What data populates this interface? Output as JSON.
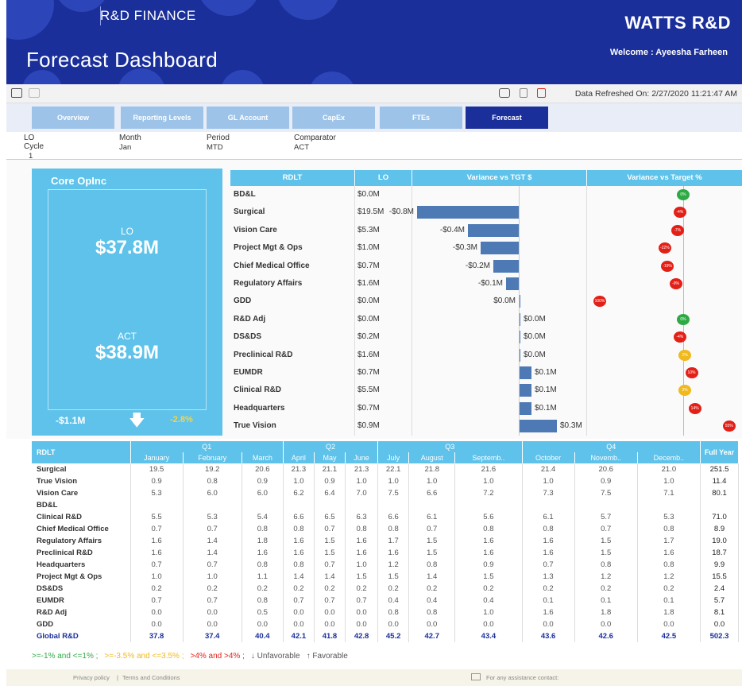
{
  "header": {
    "brand_sub": "R&D FINANCE",
    "title": "Forecast Dashboard",
    "logo": "WATTS R&D",
    "welcome": "Welcome : Ayeesha Farheen"
  },
  "toolbar": {
    "refreshed": "Data Refreshed On: 2/27/2020 11:21:47 AM",
    "icons": [
      "laptop-icon",
      "tablet-icon",
      "present-icon",
      "mobile-icon",
      "pdf-icon"
    ]
  },
  "tabs": [
    {
      "label": "Overview",
      "active": false
    },
    {
      "label": "Reporting Levels",
      "active": false
    },
    {
      "label": "GL Account",
      "active": false
    },
    {
      "label": "CapEx",
      "active": false
    },
    {
      "label": "FTEs",
      "active": false
    },
    {
      "label": "Forecast",
      "active": true
    }
  ],
  "filters": [
    {
      "label": "LO Cycle",
      "value": "1"
    },
    {
      "label": "Month",
      "value": "Jan"
    },
    {
      "label": "Period",
      "value": "MTD"
    },
    {
      "label": "Comparator",
      "value": "ACT"
    }
  ],
  "core": {
    "title": "Core OpInc",
    "lo_label": "LO",
    "lo_value": "$37.8M",
    "act_label": "ACT",
    "act_value": "$38.9M",
    "variance": "-$1.1M",
    "variance_pct": "-2.8%"
  },
  "rdlt_panel": {
    "col_rdlt": "RDLT",
    "col_lo": "LO",
    "col_var_tgt": "Variance vs TGT $",
    "col_var_pct": "Variance vs Target %",
    "rows": [
      {
        "name": "BD&L",
        "lo": "$0.0M"
      },
      {
        "name": "Surgical",
        "lo": "$19.5M"
      },
      {
        "name": "Vision Care",
        "lo": "$5.3M"
      },
      {
        "name": "Project Mgt & Ops",
        "lo": "$1.0M"
      },
      {
        "name": "Chief Medical Office",
        "lo": "$0.7M"
      },
      {
        "name": "Regulatory Affairs",
        "lo": "$1.6M"
      },
      {
        "name": "GDD",
        "lo": "$0.0M"
      },
      {
        "name": "R&D Adj",
        "lo": "$0.0M"
      },
      {
        "name": "DS&DS",
        "lo": "$0.2M"
      },
      {
        "name": "Preclinical R&D",
        "lo": "$1.6M"
      },
      {
        "name": "EUMDR",
        "lo": "$0.7M"
      },
      {
        "name": "Clinical R&D",
        "lo": "$5.5M"
      },
      {
        "name": "Headquarters",
        "lo": "$0.7M"
      },
      {
        "name": "True Vision",
        "lo": "$0.9M"
      }
    ]
  },
  "chart_data": [
    {
      "type": "bar",
      "title": "Variance vs TGT $",
      "categories": [
        "BD&L",
        "Surgical",
        "Vision Care",
        "Project Mgt & Ops",
        "Chief Medical Office",
        "Regulatory Affairs",
        "GDD",
        "R&D Adj",
        "DS&DS",
        "Preclinical R&D",
        "EUMDR",
        "Clinical R&D",
        "Headquarters",
        "True Vision"
      ],
      "values": [
        null,
        -0.8,
        -0.4,
        -0.3,
        -0.2,
        -0.1,
        0.0,
        0.0,
        0.0,
        0.0,
        0.1,
        0.1,
        0.1,
        0.3
      ],
      "labels": [
        "",
        "-$0.8M",
        "-$0.4M",
        "-$0.3M",
        "-$0.2M",
        "-$0.1M",
        "$0.0M",
        "$0.0M",
        "$0.0M",
        "$0.0M",
        "$0.1M",
        "$0.1M",
        "$0.1M",
        "$0.3M"
      ],
      "orientation": "horizontal"
    },
    {
      "type": "scatter",
      "title": "Variance vs Target %",
      "categories": [
        "BD&L",
        "Surgical",
        "Vision Care",
        "Project Mgt & Ops",
        "Chief Medical Office",
        "Regulatory Affairs",
        "GDD",
        "R&D Adj",
        "DS&DS",
        "Preclinical R&D",
        "EUMDR",
        "Clinical R&D",
        "Headquarters",
        "True Vision"
      ],
      "values": [
        0,
        -4,
        -7,
        -22,
        -19,
        -9,
        -100,
        0,
        -4,
        2,
        10,
        2,
        14,
        55
      ],
      "labels": [
        "0%",
        "-4%",
        "-7%",
        "-22%",
        "-19%",
        "-9%",
        "100%",
        "0%",
        "-4%",
        "2%",
        "10%",
        "2%",
        "14%",
        "55%"
      ],
      "colors": [
        "#2eaa44",
        "#e32018",
        "#e32018",
        "#e32018",
        "#e32018",
        "#e32018",
        "#e32018",
        "#2eaa44",
        "#e32018",
        "#f0b91e",
        "#e32018",
        "#f0b91e",
        "#e32018",
        "#e32018"
      ]
    }
  ],
  "grid": {
    "col_rdlt": "RDLT",
    "col_fy": "Full Year",
    "quarters": [
      "Q1",
      "Q2",
      "Q3",
      "Q4"
    ],
    "months": [
      "January",
      "February",
      "March",
      "April",
      "May",
      "June",
      "July",
      "August",
      "Septemb..",
      "October",
      "Novemb..",
      "Decemb.."
    ],
    "rows": [
      {
        "name": "Surgical",
        "values": [
          "19.5",
          "19.2",
          "20.6",
          "21.3",
          "21.1",
          "21.3",
          "22.1",
          "21.8",
          "21.6",
          "21.4",
          "20.6",
          "21.0"
        ],
        "fy": "251.5"
      },
      {
        "name": "True Vision",
        "values": [
          "0.9",
          "0.8",
          "0.9",
          "1.0",
          "0.9",
          "1.0",
          "1.0",
          "1.0",
          "1.0",
          "1.0",
          "0.9",
          "1.0"
        ],
        "fy": "11.4"
      },
      {
        "name": "Vision Care",
        "values": [
          "5.3",
          "6.0",
          "6.0",
          "6.2",
          "6.4",
          "7.0",
          "7.5",
          "6.6",
          "7.2",
          "7.3",
          "7.5",
          "7.1"
        ],
        "fy": "80.1"
      },
      {
        "name": "BD&L",
        "values": [
          "",
          "",
          "",
          "",
          "",
          "",
          "",
          "",
          "",
          "",
          "",
          ""
        ],
        "fy": ""
      },
      {
        "name": "Clinical R&D",
        "values": [
          "5.5",
          "5.3",
          "5.4",
          "6.6",
          "6.5",
          "6.3",
          "6.6",
          "6.1",
          "5.6",
          "6.1",
          "5.7",
          "5.3"
        ],
        "fy": "71.0"
      },
      {
        "name": "Chief Medical Office",
        "values": [
          "0.7",
          "0.7",
          "0.8",
          "0.8",
          "0.7",
          "0.8",
          "0.8",
          "0.7",
          "0.8",
          "0.8",
          "0.7",
          "0.8"
        ],
        "fy": "8.9"
      },
      {
        "name": "Regulatory Affairs",
        "values": [
          "1.6",
          "1.4",
          "1.8",
          "1.6",
          "1.5",
          "1.6",
          "1.7",
          "1.5",
          "1.6",
          "1.6",
          "1.5",
          "1.7"
        ],
        "fy": "19.0"
      },
      {
        "name": "Preclinical R&D",
        "values": [
          "1.6",
          "1.4",
          "1.6",
          "1.6",
          "1.5",
          "1.6",
          "1.6",
          "1.5",
          "1.6",
          "1.6",
          "1.5",
          "1.6"
        ],
        "fy": "18.7"
      },
      {
        "name": "Headquarters",
        "values": [
          "0.7",
          "0.7",
          "0.8",
          "0.8",
          "0.7",
          "1.0",
          "1.2",
          "0.8",
          "0.9",
          "0.7",
          "0.8",
          "0.8"
        ],
        "fy": "9.9"
      },
      {
        "name": "Project Mgt & Ops",
        "values": [
          "1.0",
          "1.0",
          "1.1",
          "1.4",
          "1.4",
          "1.5",
          "1.5",
          "1.4",
          "1.5",
          "1.3",
          "1.2",
          "1.2"
        ],
        "fy": "15.5"
      },
      {
        "name": "DS&DS",
        "values": [
          "0.2",
          "0.2",
          "0.2",
          "0.2",
          "0.2",
          "0.2",
          "0.2",
          "0.2",
          "0.2",
          "0.2",
          "0.2",
          "0.2"
        ],
        "fy": "2.4"
      },
      {
        "name": "EUMDR",
        "values": [
          "0.7",
          "0.7",
          "0.8",
          "0.7",
          "0.7",
          "0.7",
          "0.4",
          "0.4",
          "0.4",
          "0.1",
          "0.1",
          "0.1"
        ],
        "fy": "5.7"
      },
      {
        "name": "R&D Adj",
        "values": [
          "0.0",
          "0.0",
          "0.5",
          "0.0",
          "0.0",
          "0.0",
          "0.8",
          "0.8",
          "1.0",
          "1.6",
          "1.8",
          "1.8"
        ],
        "fy": "8.1"
      },
      {
        "name": "GDD",
        "values": [
          "0.0",
          "0.0",
          "0.0",
          "0.0",
          "0.0",
          "0.0",
          "0.0",
          "0.0",
          "0.0",
          "0.0",
          "0.0",
          "0.0"
        ],
        "fy": "0.0"
      },
      {
        "name": "Global R&D",
        "values": [
          "37.8",
          "37.4",
          "40.4",
          "42.1",
          "41.8",
          "42.8",
          "45.2",
          "42.7",
          "43.4",
          "43.6",
          "42.6",
          "42.5"
        ],
        "fy": "502.3",
        "total": true
      }
    ]
  },
  "legend": [
    {
      "text": ">=-1% and <=1% ;",
      "color": "#2eaa44"
    },
    {
      "text": ">=-3.5% and <=3.5% ;",
      "color": "#f0b91e"
    },
    {
      "text": ">4% and >4% ;",
      "color": "#e32018"
    },
    {
      "text": "↓ Unfavorable",
      "color": "#555555"
    },
    {
      "text": "↑ Favorable",
      "color": "#555555"
    }
  ],
  "footer": {
    "privacy": "Privacy policy",
    "terms": "Terms and Conditions",
    "contact": "For any assistance contact:"
  }
}
